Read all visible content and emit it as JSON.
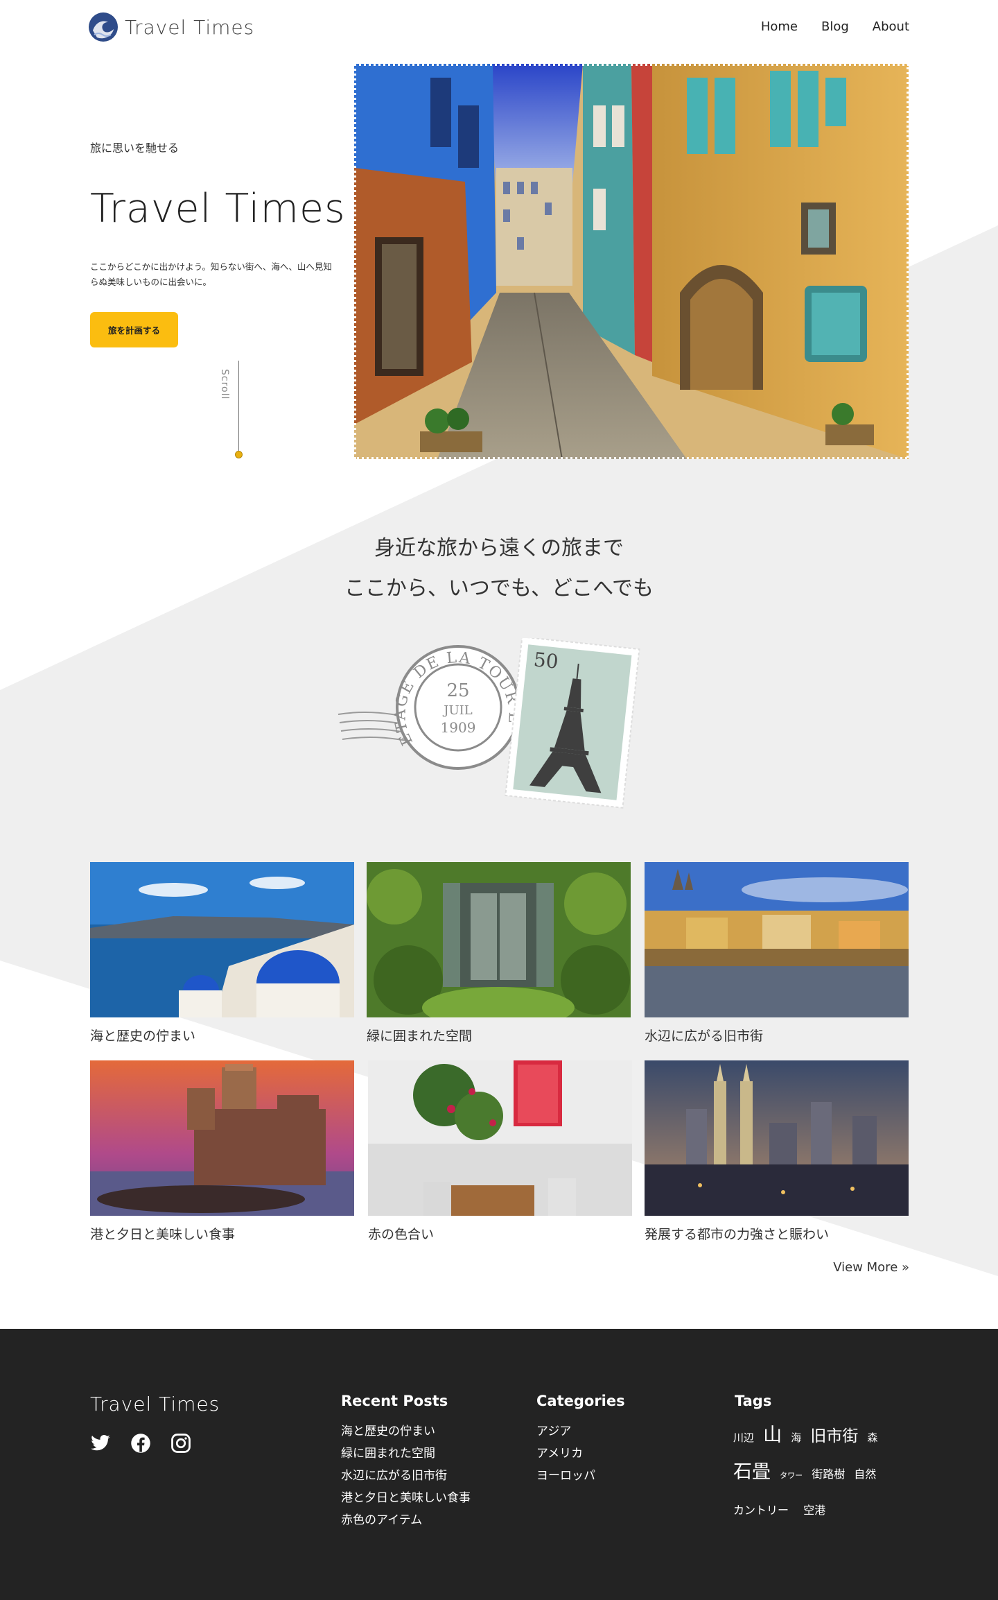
{
  "header": {
    "logo_text": "Travel Times",
    "nav": [
      "Home",
      "Blog",
      "About"
    ]
  },
  "hero": {
    "subtitle": "旅に思いを馳せる",
    "title": "Travel Times",
    "description": "ここからどこかに出かけよう。知らない街へ、海へ、山へ見知らぬ美味しいものに出会いに。",
    "button_label": "旅を計画する",
    "scroll_label": "Scroll"
  },
  "tagline": {
    "line1": "身近な旅から遠くの旅まで",
    "line2": "ここから、いつでも、どこへでも"
  },
  "stamp": {
    "value": "50",
    "postmark_text": "ETAGE DE LA TOUR EIFFEL",
    "postmark_date_day": "25",
    "postmark_date_month": "JUIL",
    "postmark_date_year": "1909"
  },
  "gallery": {
    "items": [
      {
        "caption": "海と歴史の佇まい"
      },
      {
        "caption": "緑に囲まれた空間"
      },
      {
        "caption": "水辺に広がる旧市街"
      },
      {
        "caption": "港と夕日と美味しい食事"
      },
      {
        "caption": "赤の色合い"
      },
      {
        "caption": "発展する都市の力強さと賑わい"
      }
    ],
    "view_more": "View More »"
  },
  "footer": {
    "brand": "Travel Times",
    "social": [
      "twitter-icon",
      "facebook-icon",
      "instagram-icon"
    ],
    "recent_posts": {
      "heading": "Recent Posts",
      "items": [
        "海と歴史の佇まい",
        "緑に囲まれた空間",
        "水辺に広がる旧市街",
        "港と夕日と美味しい食事",
        "赤色のアイテム"
      ]
    },
    "categories": {
      "heading": "Categories",
      "items": [
        "アジア",
        "アメリカ",
        "ヨーロッパ"
      ]
    },
    "tags": {
      "heading": "Tags",
      "items": [
        "川辺",
        "山",
        "海",
        "旧市街",
        "森",
        "石畳",
        "タワー",
        "街路樹",
        "自然",
        "カントリー",
        "空港"
      ]
    }
  },
  "colors": {
    "accent": "#fbbd10",
    "footer_bg": "#232323",
    "band_gray": "#efefef"
  }
}
